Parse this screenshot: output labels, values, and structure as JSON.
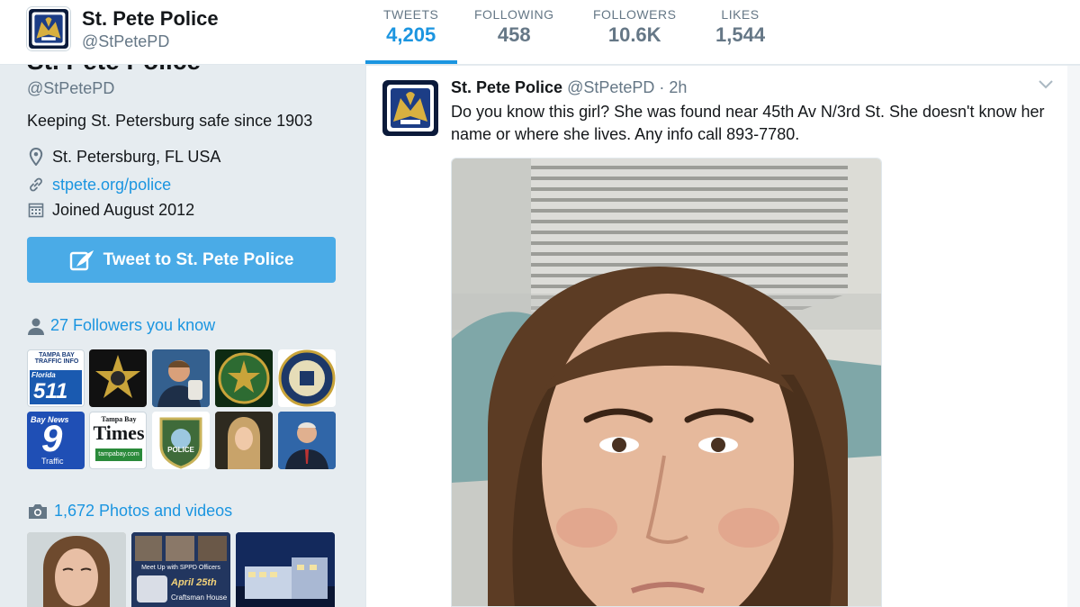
{
  "profile": {
    "name": "St. Pete Police",
    "handle": "@StPetePD",
    "bio": "Keeping St. Petersburg safe since 1903",
    "location": "St. Petersburg, FL USA",
    "website": "stpete.org/police",
    "joined": "Joined August 2012"
  },
  "stats": [
    {
      "label": "TWEETS",
      "value": "4,205"
    },
    {
      "label": "FOLLOWING",
      "value": "458"
    },
    {
      "label": "FOLLOWERS",
      "value": "10.6K"
    },
    {
      "label": "LIKES",
      "value": "1,544"
    }
  ],
  "sidebar": {
    "tweet_to_label": "Tweet to St. Pete Police",
    "followers_you_know": "27 Followers you know",
    "photos_videos": "1,672 Photos and videos"
  },
  "follower_tiles": [
    {
      "top": "TAMPA BAY TRAFFIC INFO",
      "mid": "Florida",
      "big": "511"
    },
    {
      "label": ""
    },
    {
      "label": ""
    },
    {
      "label": ""
    },
    {
      "label": ""
    },
    {
      "top": "Bay News",
      "big": "9",
      "bottom": "Traffic"
    },
    {
      "top": "Tampa Bay",
      "big": "Times",
      "bottom": "tampabay.com"
    },
    {
      "label": "POLICE"
    },
    {
      "label": ""
    },
    {
      "label": ""
    }
  ],
  "photo_tiles": [
    {
      "label": ""
    },
    {
      "line1": "Meet Up with SPPD Officers",
      "line2": "April 25th",
      "line3": "Craftsman House"
    },
    {
      "label": ""
    }
  ],
  "tweet": {
    "name": "St. Pete Police",
    "handle": "@StPetePD",
    "time": "· 2h",
    "text": "Do you know this girl? She was found near 45th Av N/3rd St. She doesn't know her name or where she lives. Any info call  893-7780."
  },
  "colors": {
    "accent": "#1b95e0",
    "button": "#4aabe7",
    "muted": "#657786",
    "background": "#e6ecf0"
  }
}
